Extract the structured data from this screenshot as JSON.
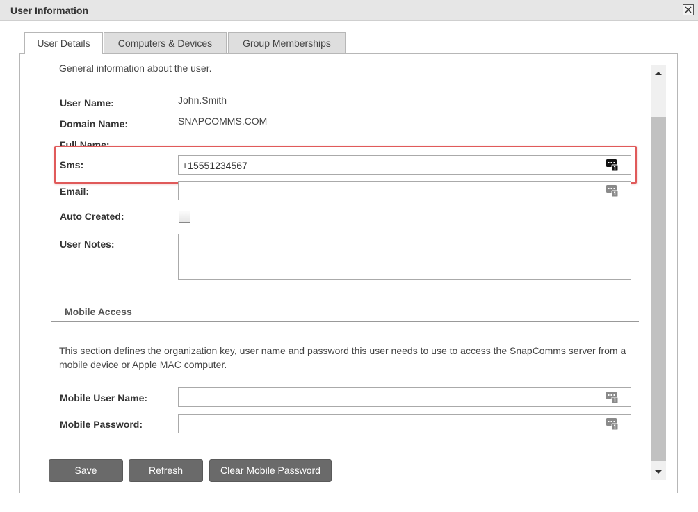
{
  "window": {
    "title": "User Information"
  },
  "tabs": [
    {
      "label": "User Details",
      "active": true
    },
    {
      "label": "Computers & Devices",
      "active": false
    },
    {
      "label": "Group Memberships",
      "active": false
    }
  ],
  "details": {
    "intro": "General information about the user.",
    "user_name_label": "User Name:",
    "user_name_value": "John.Smith",
    "domain_name_label": "Domain Name:",
    "domain_name_value": "SNAPCOMMS.COM",
    "full_name_label": "Full Name:",
    "sms_label": "Sms:",
    "sms_value": "+15551234567",
    "email_label": "Email:",
    "email_value": "",
    "auto_created_label": "Auto Created:",
    "auto_created_checked": false,
    "user_notes_label": "User Notes:",
    "user_notes_value": ""
  },
  "mobile": {
    "title": "Mobile Access",
    "description": "This section defines the organization key, user name and password this user needs to use to access the SnapComms server from a mobile device or Apple MAC computer.",
    "user_name_label": "Mobile User Name:",
    "user_name_value": "",
    "password_label": "Mobile Password:",
    "password_value": ""
  },
  "buttons": {
    "save": "Save",
    "refresh": "Refresh",
    "clear_mobile_password": "Clear Mobile Password"
  },
  "icons": {
    "close": "close-icon",
    "keyboard": "keyboard-icon",
    "scroll_up": "scroll-up-icon",
    "scroll_down": "scroll-down-icon"
  },
  "colors": {
    "highlight": "#e05a5a",
    "button_bg": "#6a6a6a"
  }
}
